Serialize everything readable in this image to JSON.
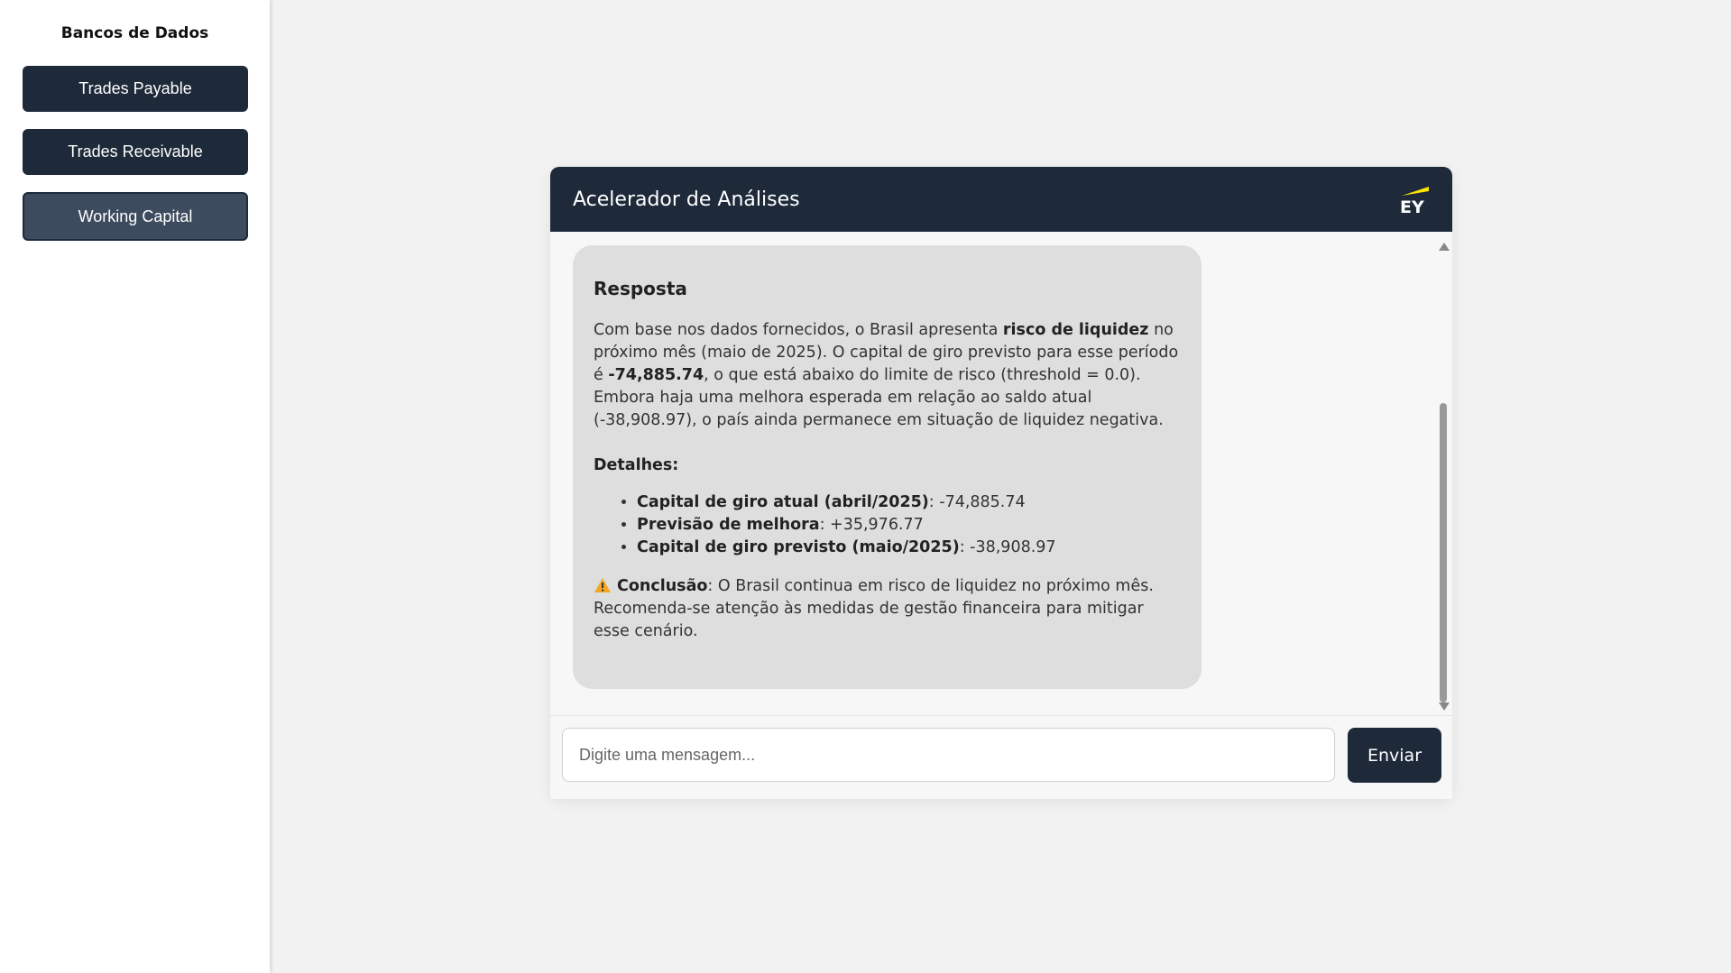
{
  "sidebar": {
    "title": "Bancos de Dados",
    "items": [
      {
        "label": "Trades Payable"
      },
      {
        "label": "Trades Receivable"
      },
      {
        "label": "Working Capital",
        "active": true
      }
    ]
  },
  "chat": {
    "title": "Acelerador de Análises",
    "logo": {
      "text": "EY",
      "accent": "#ffe600"
    },
    "message": {
      "heading": "Resposta",
      "p1_a": "Com base nos dados fornecidos, o Brasil apresenta ",
      "p1_b": "risco de liquidez",
      "p1_c": " no próximo mês (maio de 2025). O capital de giro previsto para esse período é ",
      "p1_d": "-74,885.74",
      "p1_e": ", o que está abaixo do limite de risco (threshold = 0.0). Embora haja uma melhora esperada em relação ao saldo atual (-38,908.97), o país ainda permanece em situação de liquidez negativa.",
      "details_label": "Detalhes:",
      "details": [
        {
          "label": "Capital de giro atual (abril/2025)",
          "value": ": -74,885.74"
        },
        {
          "label": "Previsão de melhora",
          "value": ": +35,976.77"
        },
        {
          "label": "Capital de giro previsto (maio/2025)",
          "value": ": -38,908.97"
        }
      ],
      "conclusion_icon": "warning-icon",
      "conclusion_label": "Conclusão",
      "conclusion_text": ": O Brasil continua em risco de liquidez no próximo mês. Recomenda-se atenção às medidas de gestão financeira para mitigar esse cenário."
    },
    "input": {
      "placeholder": "Digite uma mensagem...",
      "value": ""
    },
    "send_label": "Enviar"
  },
  "colors": {
    "primary": "#1e2a3a",
    "active": "#3d4b5e",
    "bubble": "#dedede",
    "background": "#f2f2f2",
    "warning": "#f5a623"
  }
}
